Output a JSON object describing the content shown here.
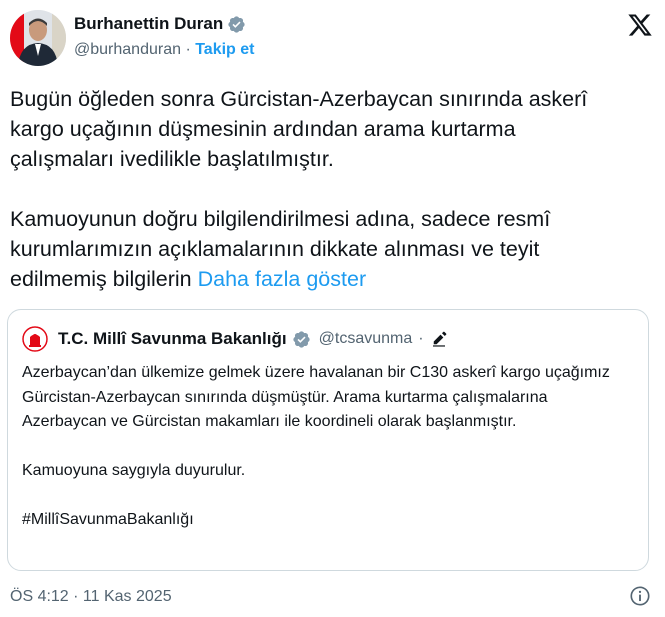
{
  "author": {
    "name": "Burhanettin Duran",
    "handle": "@burhanduran",
    "separator": "·",
    "follow_label": "Takip et"
  },
  "tweet": {
    "paragraph1": "Bugün öğleden sonra Gürcistan-Azerbaycan sınırında askerî kargo uçağının düşmesinin ardından arama kurtarma çalışmaları ivedilikle başlatılmıştır.",
    "paragraph2": "Kamuoyunun doğru bilgilendirilmesi adına, sadece resmî kurumlarımızın açıklamalarının dikkate alınması ve teyit edilmemiş bilgilerin ",
    "show_more_label": "Daha fazla göster"
  },
  "quoted": {
    "name": "T.C. Millî Savunma Bakanlığı",
    "handle": "@tcsavunma",
    "separator": "·",
    "paragraphs": {
      "p1": "Azerbaycan’dan ülkemize gelmek üzere havalanan bir C130 askerî kargo uçağımız Gürcistan-Azerbaycan sınırında düşmüştür. Arama kurtarma çalışmalarına Azerbaycan ve Gürcistan makamları ile koordineli olarak başlanmıştır.",
      "p2": "Kamuoyuna saygıyla duyurulur.",
      "p3": "#MillîSavunmaBakanlığı"
    }
  },
  "footer": {
    "timestamp": "ÖS 4:12 · 11 Kas 2025"
  },
  "icons": {
    "verified": "verified-badge-icon",
    "x_logo": "x-logo-icon",
    "edit": "edit-pencil-icon",
    "info": "info-icon"
  },
  "colors": {
    "accent": "#1d9bf0",
    "text": "#0f1419",
    "muted": "#536471",
    "border": "#cfd9de",
    "flag_red": "#e30a17"
  }
}
